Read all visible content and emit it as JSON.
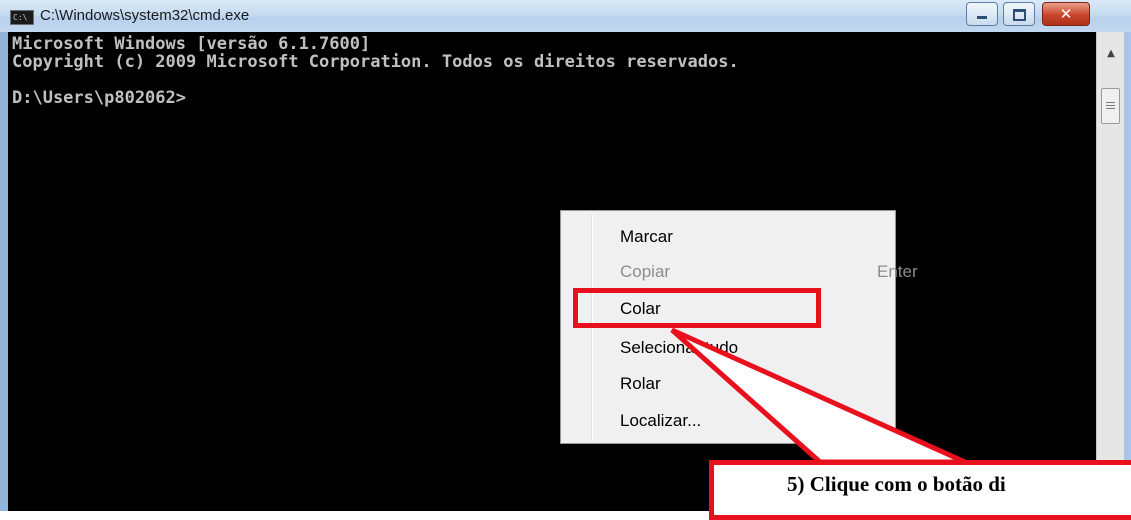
{
  "window": {
    "title": "C:\\Windows\\system32\\cmd.exe",
    "icon_label": "C:\\",
    "controls": {
      "minimize": "minimize-icon",
      "maximize": "maximize-icon",
      "close": "close-icon",
      "close_glyph": "✕"
    }
  },
  "console": {
    "lines": [
      "Microsoft Windows [versão 6.1.7600]",
      "Copyright (c) 2009 Microsoft Corporation. Todos os direitos reservados.",
      "",
      "D:\\Users\\p802062>"
    ],
    "text_color": "#c0c0c0",
    "background": "#000000"
  },
  "scrollbar": {
    "up_arrow": "▲"
  },
  "context_menu": {
    "items": [
      {
        "label": "Marcar",
        "enabled": true
      },
      {
        "label": "Copiar",
        "shortcut": "Enter",
        "enabled": false
      },
      {
        "label": "Colar",
        "enabled": true
      },
      {
        "label": "Selecionar tudo",
        "enabled": true
      },
      {
        "label": "Rolar",
        "enabled": true
      },
      {
        "label": "Localizar...",
        "enabled": true
      }
    ]
  },
  "annotation": {
    "color": "#e8101c",
    "callout_text": "5)  Clique com o botão di"
  }
}
